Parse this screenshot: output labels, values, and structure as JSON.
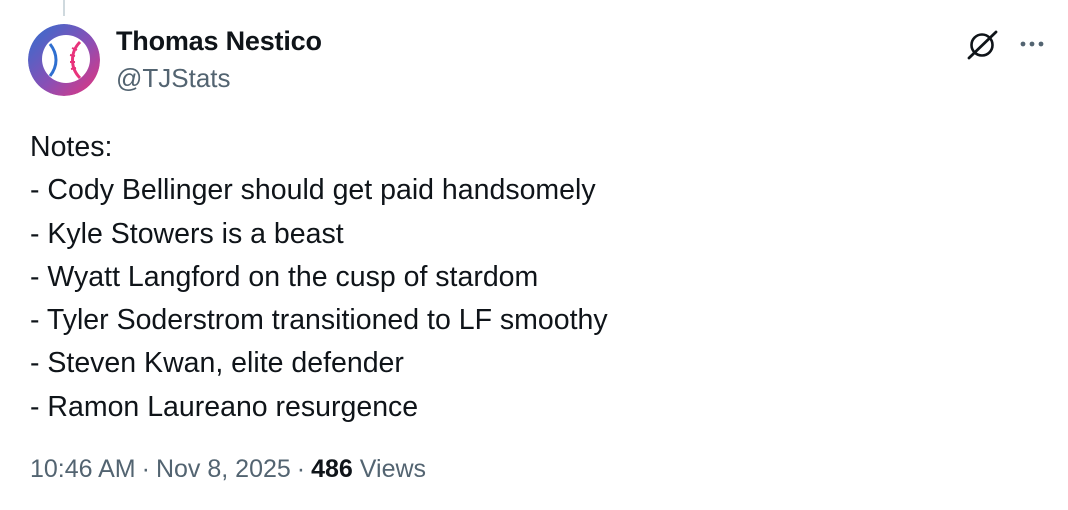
{
  "tweet": {
    "author": {
      "display_name": "Thomas Nestico",
      "handle": "@TJStats",
      "avatar_icon": "baseball-gradient-avatar",
      "avatar_colors": [
        "#3b7dd8",
        "#e0357e"
      ]
    },
    "body_lines": [
      "Notes:",
      "- Cody Bellinger should get paid handsomely",
      "- Kyle Stowers is a beast",
      "- Wyatt Langford on the cusp of stardom",
      "- Tyler Soderstrom transitioned to LF smoothy",
      "- Steven Kwan, elite defender",
      "- Ramon Laureano resurgence"
    ],
    "meta": {
      "time": "10:46 AM",
      "date": "Nov 8, 2025",
      "separator": "·",
      "views_count": "486",
      "views_label": "Views"
    },
    "actions": {
      "grok_icon": "grok-icon",
      "more_icon": "more-icon"
    }
  }
}
